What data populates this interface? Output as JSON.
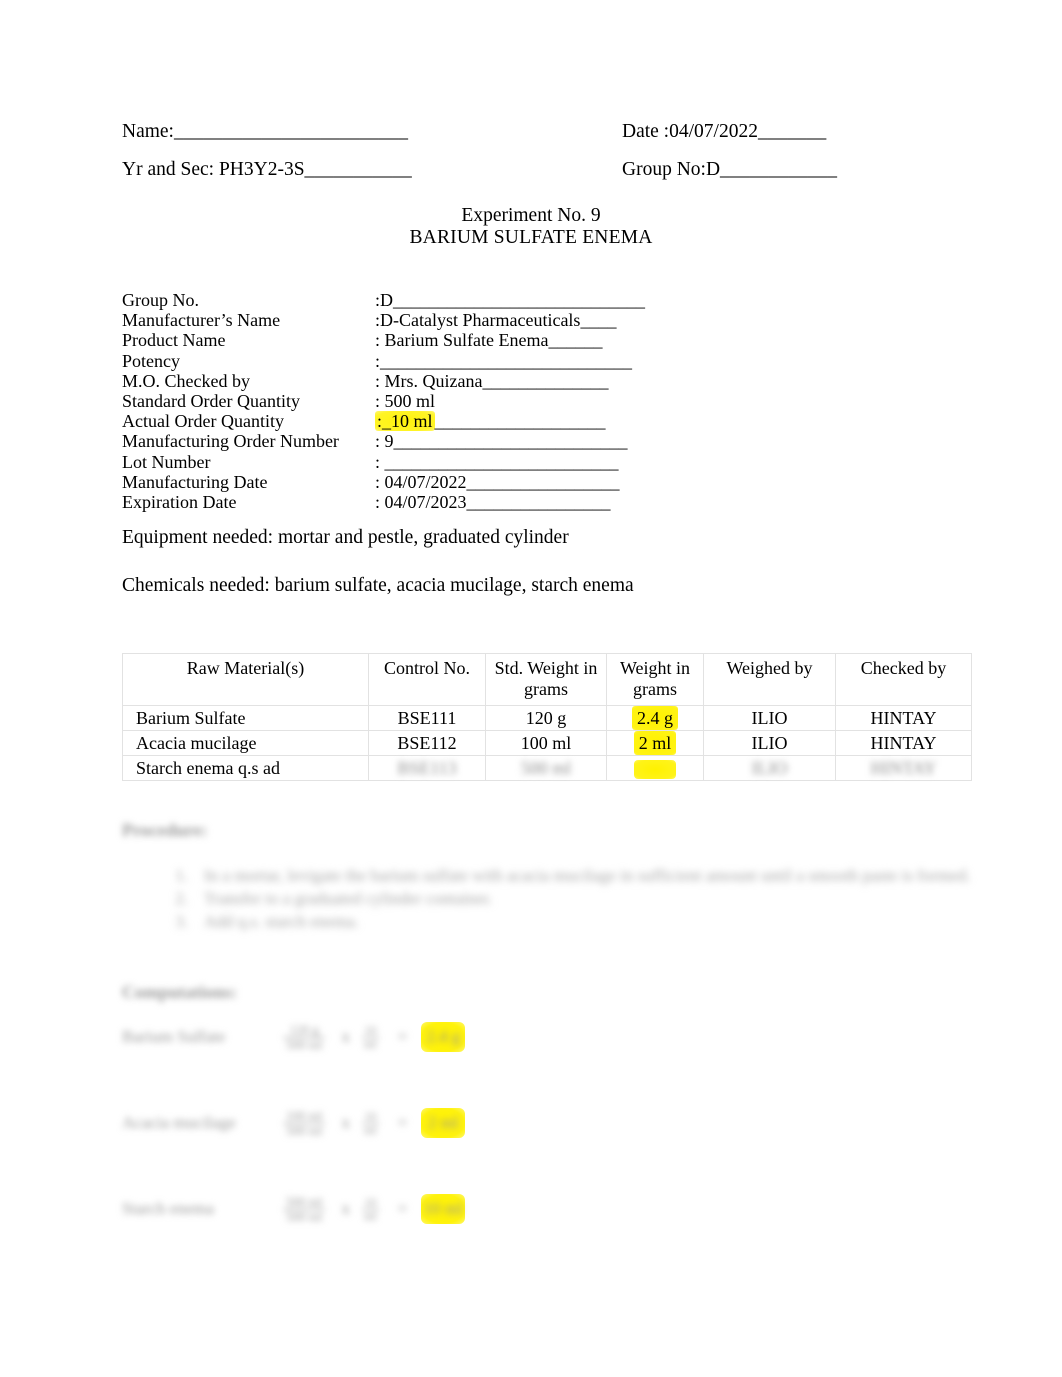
{
  "header": {
    "name_label": "Name:",
    "name_blank": "________________________",
    "date_label": "Date :",
    "date_value": "04/07/2022",
    "date_blank": "_______",
    "yrsec_label": "Yr and Sec: ",
    "yrsec_value": "PH3Y2-3S",
    "yrsec_blank": "___________",
    "group_label": "Group No:",
    "group_value": "D",
    "group_blank": "____________"
  },
  "title": {
    "experiment": "Experiment No. 9",
    "name": "BARIUM SULFATE ENEMA"
  },
  "info": [
    {
      "label": "Group No.",
      "value": ":D",
      "blank": "____________________________",
      "highlight": false
    },
    {
      "label": "Manufacturer’s Name",
      "value": ":D-Catalyst Pharmaceuticals",
      "blank": "____",
      "highlight": false
    },
    {
      "label": "Product Name",
      "value": ": Barium Sulfate Enema",
      "blank": "______",
      "highlight": false
    },
    {
      "label": "Potency",
      "value": ":",
      "blank": "____________________________",
      "highlight": false
    },
    {
      "label": "M.O. Checked by",
      "value": ": Mrs. Quizana",
      "blank": "______________",
      "highlight": false
    },
    {
      "label": "Standard Order Quantity",
      "value": ": 500 ml",
      "blank": "",
      "highlight": false
    },
    {
      "label": "Actual Order Quantity",
      "value": ":_10 ml",
      "blank": "___________________",
      "highlight": true
    },
    {
      "label": "Manufacturing Order Number",
      "value": ": 9",
      "blank": "__________________________",
      "highlight": false
    },
    {
      "label": "Lot Number",
      "value": ": ",
      "blank": "__________________________",
      "highlight": false
    },
    {
      "label": "Manufacturing Date",
      "value": ": 04/07/2022",
      "blank": "_________________",
      "highlight": false
    },
    {
      "label": "Expiration Date",
      "value": ": 04/07/2023",
      "blank": "________________",
      "highlight": false
    }
  ],
  "paragraphs": {
    "equipment": "Equipment needed: mortar and pestle, graduated cylinder",
    "chemicals": "Chemicals needed: barium sulfate, acacia mucilage, starch enema"
  },
  "table": {
    "headers": [
      "Raw Material(s)",
      "Control No.",
      "Std. Weight in grams",
      "Weight in grams",
      "Weighed by",
      "Checked by"
    ],
    "rows": [
      {
        "raw_material": "Barium Sulfate",
        "control_no": "BSE111",
        "std_weight": "120 g",
        "weight": "2.4 g",
        "weight_highlight": true,
        "weighed_by": "ILIO",
        "checked_by": "HINTAY",
        "obscured": false
      },
      {
        "raw_material": "Acacia mucilage",
        "control_no": "BSE112",
        "std_weight": "100 ml",
        "weight": "2 ml",
        "weight_highlight": true,
        "weighed_by": "ILIO",
        "checked_by": "HINTAY",
        "obscured": false
      },
      {
        "raw_material": "Starch enema q.s ad",
        "control_no": "BSE113",
        "std_weight": "500 ml",
        "weight": "",
        "weight_highlight": true,
        "weighed_by": "ILIO",
        "checked_by": "HINTAY",
        "obscured": true
      }
    ]
  },
  "procedure": {
    "heading": "Procedure:",
    "items": [
      "In a mortar, levigate the barium sulfate with acacia mucilage in sufficient amount until a smooth paste is formed.",
      "Transfer to a graduated cylinder container.",
      "Add q.s. starch enema."
    ]
  },
  "computation": {
    "heading": "Computations:",
    "rows": [
      {
        "label": "Barium Sulfate",
        "numerator": "120 g",
        "denominator": "500 ml",
        "operator": "x",
        "factor_num": "10",
        "factor_den": "ml",
        "equals": "=",
        "result": "2.4 g"
      },
      {
        "label": "Acacia mucilage",
        "numerator": "100 ml",
        "denominator": "500 ml",
        "operator": "x",
        "factor_num": "10",
        "factor_den": "ml",
        "equals": "=",
        "result": "2 ml"
      },
      {
        "label": "Starch enema",
        "numerator": "500 ml",
        "denominator": "500 ml",
        "operator": "x",
        "factor_num": "10",
        "factor_den": "ml",
        "equals": "=",
        "result": "10 ml"
      }
    ]
  },
  "colors": {
    "highlight": "#fff200",
    "text": "#000000",
    "table_border": "#e2e2e2"
  }
}
